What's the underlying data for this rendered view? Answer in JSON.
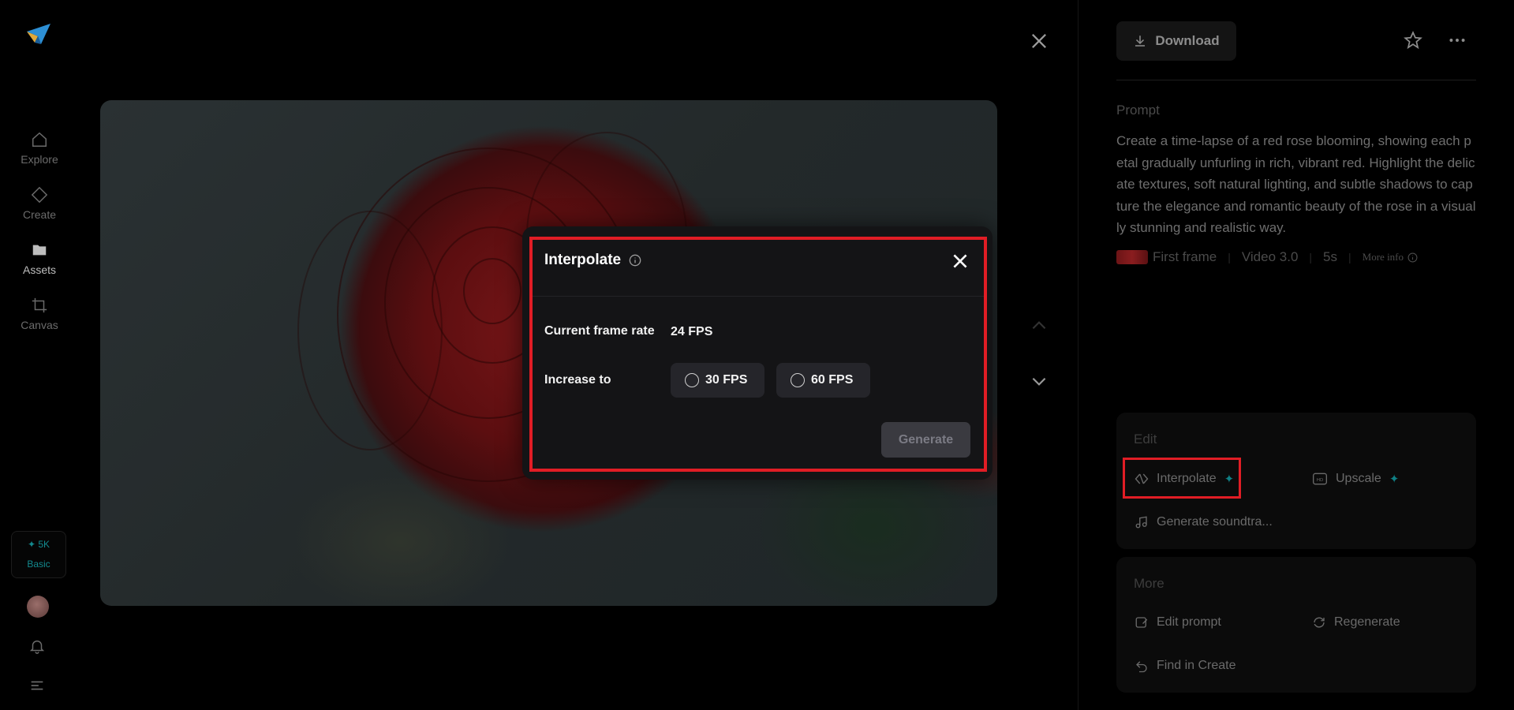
{
  "nav": {
    "items": [
      {
        "label": "Explore",
        "icon": "home-icon"
      },
      {
        "label": "Create",
        "icon": "diamond-icon"
      },
      {
        "label": "Assets",
        "icon": "folder-icon"
      },
      {
        "label": "Canvas",
        "icon": "crop-icon"
      }
    ],
    "credits": {
      "amount": "✦ 5K",
      "plan": "Basic"
    }
  },
  "header": {
    "download_label": "Download"
  },
  "prompt": {
    "label": "Prompt",
    "text": "Create a time-lapse of a red rose blooming, showing each petal gradually unfurling in rich, vibrant red. Highlight the delicate textures, soft natural lighting, and subtle shadows to capture the elegance and romantic beauty of the rose in a visually stunning and realistic way.",
    "meta": {
      "frame": "First frame",
      "model": "Video 3.0",
      "duration": "5s",
      "more_info": "More info"
    }
  },
  "edit": {
    "title": "Edit",
    "interpolate": "Interpolate",
    "upscale": "Upscale",
    "soundtrack": "Generate soundtra..."
  },
  "more": {
    "title": "More",
    "edit_prompt": "Edit prompt",
    "regenerate": "Regenerate",
    "find_in_create": "Find in Create"
  },
  "modal": {
    "title": "Interpolate",
    "current_label": "Current frame rate",
    "current_value": "24 FPS",
    "increase_label": "Increase to",
    "options": [
      "30 FPS",
      "60 FPS"
    ],
    "generate_label": "Generate"
  },
  "colors": {
    "accent": "#0f7f84",
    "highlight": "#e11d25"
  }
}
